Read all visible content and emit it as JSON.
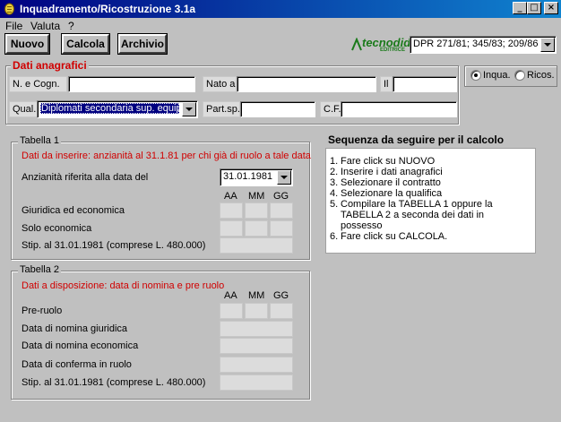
{
  "window": {
    "title": "Inquadramento/Ricostruzione 3.1a",
    "min": "_",
    "max": "□",
    "close": "×"
  },
  "menu": [
    "File",
    "Valuta",
    "?"
  ],
  "toolbar": {
    "nuovo": "Nuovo",
    "calcola": "Calcola",
    "archivio": "Archivio",
    "logo_main": "tecnodid",
    "logo_sub": "EDITRICE",
    "dpr_select": "DPR 271/81; 345/83; 209/86"
  },
  "anagrafici": {
    "title": "Dati anagrafici",
    "name_label": "N. e Cogn.",
    "born_label": "Nato a",
    "il_label": "Il",
    "qual_label": "Qual.",
    "qual_value": "Diplomati secondaria sup. equip.",
    "partsp_label": "Part.sp.",
    "cf_label": "C.F."
  },
  "mode": {
    "option1": "Inqua.",
    "option2": "Ricos.",
    "selected": "Inqua."
  },
  "tabella1": {
    "title": "Tabella 1",
    "note": "Dati da inserire: anzianità al 31.1.81 per chi già di ruolo a tale data",
    "ref_label": "Anzianità riferita alla data del",
    "ref_value": "31.01.1981",
    "col_aa": "AA",
    "col_mm": "MM",
    "col_gg": "GG",
    "row1": "Giuridica ed economica",
    "row2": "Solo economica",
    "row3": "Stip. al 31.01.1981 (comprese L. 480.000)"
  },
  "tabella2": {
    "title": "Tabella 2",
    "note": "Dati a disposizione: data di nomina e pre ruolo",
    "col_aa": "AA",
    "col_mm": "MM",
    "col_gg": "GG",
    "row1": "Pre-ruolo",
    "row2": "Data di nomina giuridica",
    "row3": "Data di nomina economica",
    "row4": "Data di conferma in ruolo",
    "row5": "Stip. al 31.01.1981 (comprese L. 480.000)"
  },
  "sequence": {
    "title": "Sequenza da seguire per il calcolo",
    "steps": [
      {
        "n": "1.",
        "text": "Fare click su NUOVO"
      },
      {
        "n": "2.",
        "text": "Inserire i dati anagrafici"
      },
      {
        "n": "3.",
        "text": "Selezionare il contratto"
      },
      {
        "n": "4.",
        "text": "Selezionare la qualifica"
      },
      {
        "n": "5.",
        "text": "Compilare la TABELLA 1 oppure la TABELLA 2 a seconda dei dati in possesso"
      },
      {
        "n": "6.",
        "text": "Fare click su CALCOLA."
      }
    ]
  }
}
